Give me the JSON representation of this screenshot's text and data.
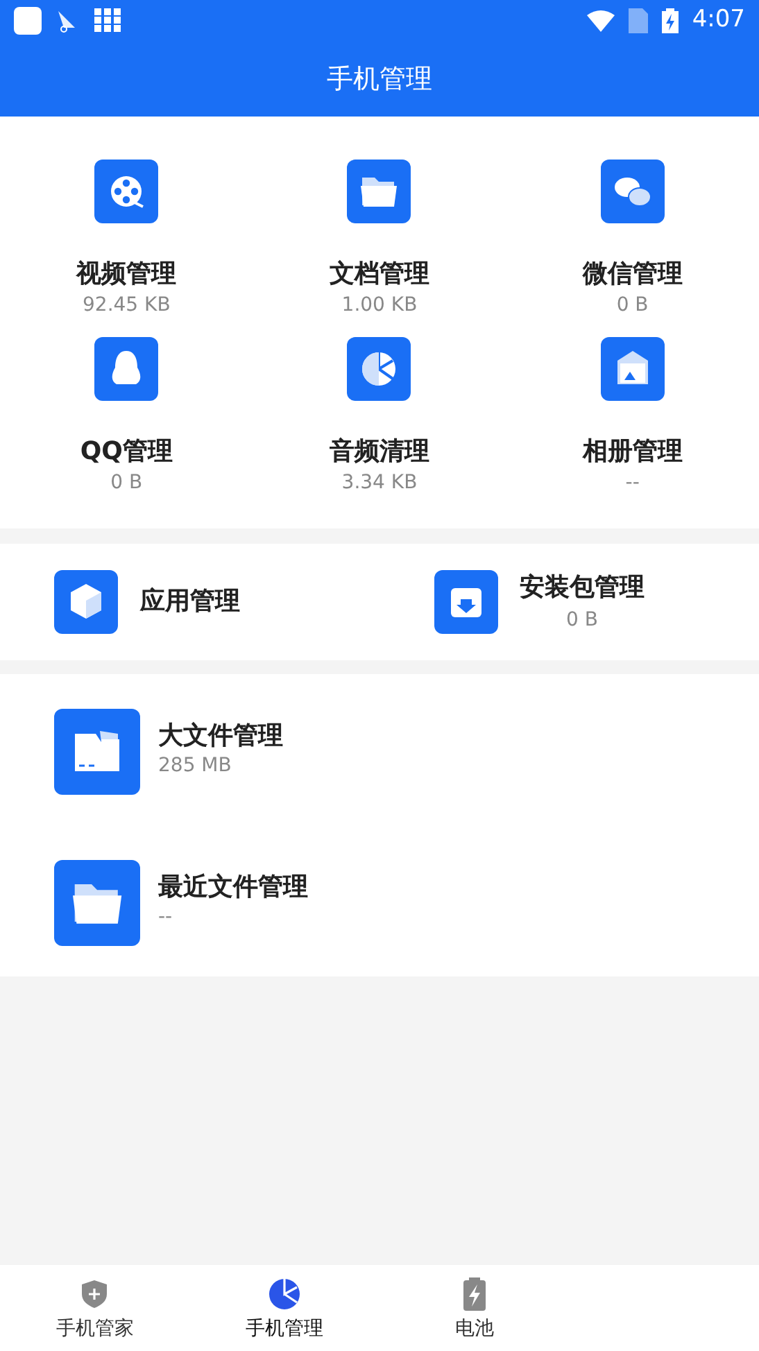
{
  "status_bar": {
    "time": "4:07"
  },
  "header": {
    "title": "手机管理"
  },
  "grid": [
    {
      "label": "视频管理",
      "size": "92.45 KB"
    },
    {
      "label": "文档管理",
      "size": "1.00 KB"
    },
    {
      "label": "微信管理",
      "size": "0 B"
    },
    {
      "label": "QQ管理",
      "size": "0 B"
    },
    {
      "label": "音频清理",
      "size": "3.34 KB"
    },
    {
      "label": "相册管理",
      "size": "--"
    }
  ],
  "apps_row": [
    {
      "label": "应用管理"
    },
    {
      "label": "安装包管理",
      "size": "0 B"
    }
  ],
  "file_list": [
    {
      "label": "大文件管理",
      "size": "285 MB"
    },
    {
      "label": "最近文件管理",
      "size": "--"
    }
  ],
  "tabs": [
    {
      "label": "手机管家",
      "selected": false
    },
    {
      "label": "手机管理",
      "selected": true
    },
    {
      "label": "电池",
      "selected": false
    }
  ]
}
